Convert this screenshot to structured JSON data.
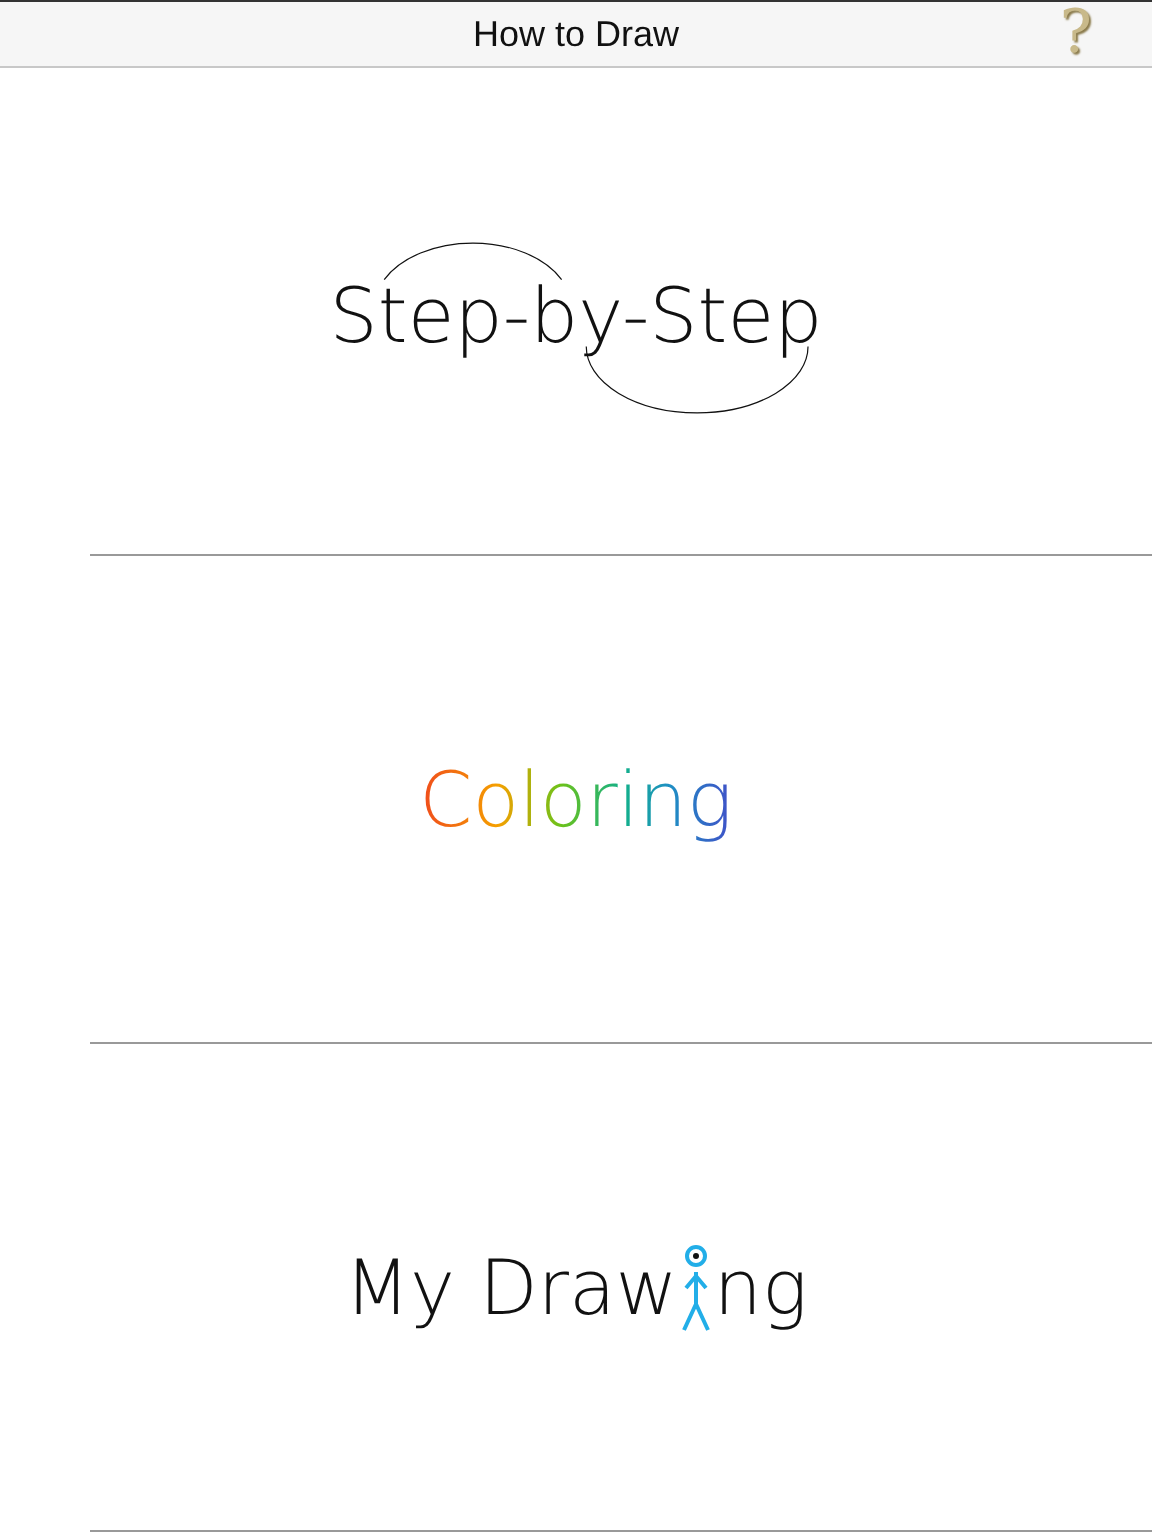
{
  "header": {
    "title": "How to Draw",
    "help": "?"
  },
  "menu": [
    {
      "kind": "step",
      "label": "Step-by-Step"
    },
    {
      "kind": "coloring",
      "label": "Coloring"
    },
    {
      "kind": "drawing",
      "before": "My Draw",
      "after": "ng"
    }
  ]
}
